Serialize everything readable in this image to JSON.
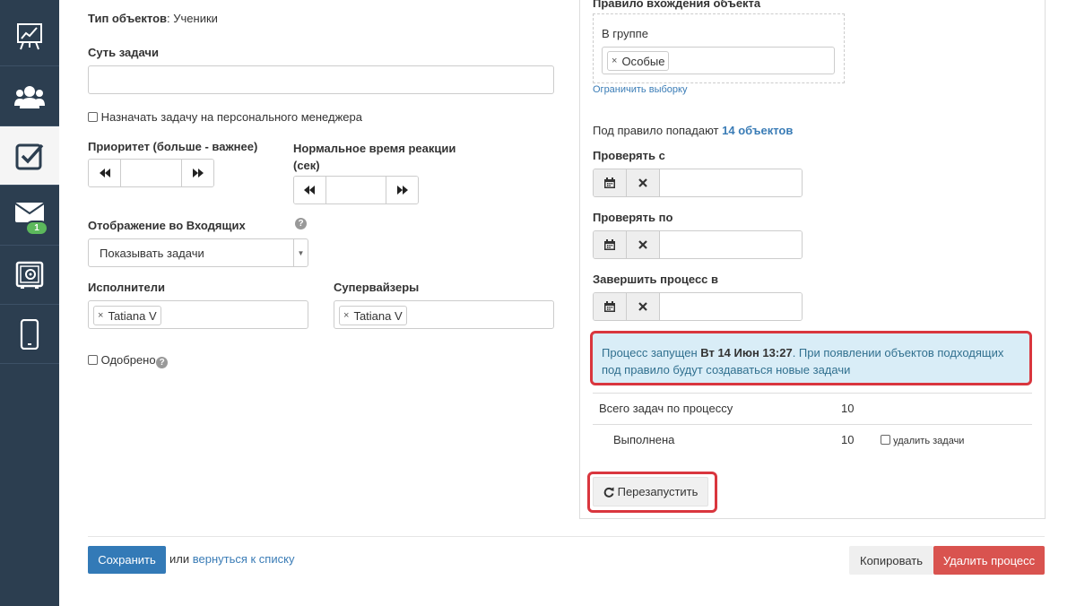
{
  "sidebar": {
    "items": [
      {
        "icon": "chart-easel-icon"
      },
      {
        "icon": "users-group-icon"
      },
      {
        "icon": "checkbox-tasks-icon",
        "active": true
      },
      {
        "icon": "envelope-icon",
        "badge": "1"
      },
      {
        "icon": "safe-box-icon"
      },
      {
        "icon": "mobile-phone-icon"
      }
    ]
  },
  "form": {
    "object_type_label": "Тип объектов",
    "object_type_value": ": Ученики",
    "task_essence_label": "Суть задачи",
    "task_essence_value": "",
    "assign_manager_label": "Назначать задачу на персонального менеджера",
    "priority_label": "Приоритет (больше - важнее)",
    "priority_value": "",
    "reaction_time_label_1": "Нормальное время реакции",
    "reaction_time_label_2": "(сек)",
    "reaction_time_value": "",
    "inbox_display_label": "Отображение во Входящих",
    "inbox_display_value": "Показывать задачи",
    "executors_label": "Исполнители",
    "executors": [
      "Tatiana V"
    ],
    "supervisors_label": "Супервайзеры",
    "supervisors": [
      "Tatiana V"
    ],
    "approved_label": "Одобрено"
  },
  "rule_panel": {
    "title": "Правило вхождения объекта",
    "in_group_label": "В группе",
    "group_tags": [
      "Особые"
    ],
    "limit_selection_link": "Ограничить выборку",
    "matching_text": "Под правило попадают",
    "matching_count": "14 объектов",
    "check_from_label": "Проверять с",
    "check_to_label": "Проверять по",
    "finish_label": "Завершить процесс в",
    "alert_prefix": "Процесс запущен ",
    "alert_date": "Вт 14 Июн 13:27",
    "alert_suffix": ". При появлении объектов подходящих под правило будут создаваться новые задачи",
    "stats": {
      "total_label": "Всего задач по процессу",
      "total_value": "10",
      "done_label": "Выполнена",
      "done_value": "10",
      "delete_tasks_label": "удалить задачи"
    },
    "restart_button": "Перезапустить"
  },
  "footer": {
    "save_button": "Сохранить",
    "or_text": "или",
    "back_link": "вернуться к списку",
    "copy_button": "Копировать",
    "delete_button": "Удалить процесс"
  },
  "colors": {
    "sidebar_bg": "#2c3e50",
    "primary": "#337ab7",
    "danger": "#d9534f",
    "alert_bg": "#d9edf7",
    "highlight_border": "#d9363e",
    "badge": "#5cb85c"
  }
}
